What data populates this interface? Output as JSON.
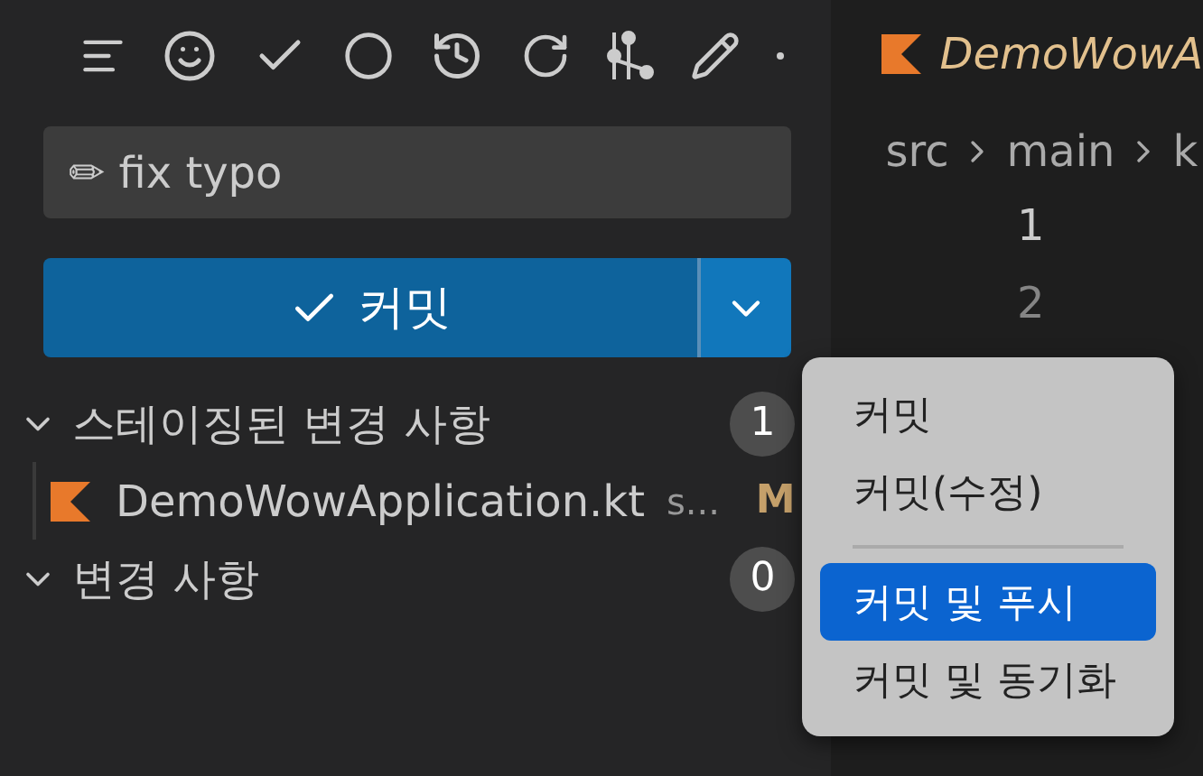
{
  "commit_message": {
    "value": "✏ fix typo"
  },
  "commit_button": {
    "label": "커밋"
  },
  "sections": [
    {
      "title": "스테이징된 변경 사항",
      "count": "1",
      "expanded": true,
      "files": [
        {
          "name": "DemoWowApplication.kt",
          "path": "s...",
          "status": "M"
        }
      ]
    },
    {
      "title": "변경 사항",
      "count": "0",
      "expanded": true
    }
  ],
  "editor": {
    "tab": {
      "title": "DemoWowA"
    },
    "breadcrumb": [
      "src",
      "main",
      "k"
    ],
    "line_numbers": [
      "1",
      "2"
    ]
  },
  "menu": {
    "items": [
      {
        "label": "커밋",
        "kind": "item",
        "selected": false
      },
      {
        "label": "커밋(수정)",
        "kind": "item",
        "selected": false
      },
      {
        "kind": "separator"
      },
      {
        "label": "커밋 및 푸시",
        "kind": "item",
        "selected": true
      },
      {
        "label": "커밋 및 동기화",
        "kind": "item",
        "selected": false
      }
    ]
  }
}
